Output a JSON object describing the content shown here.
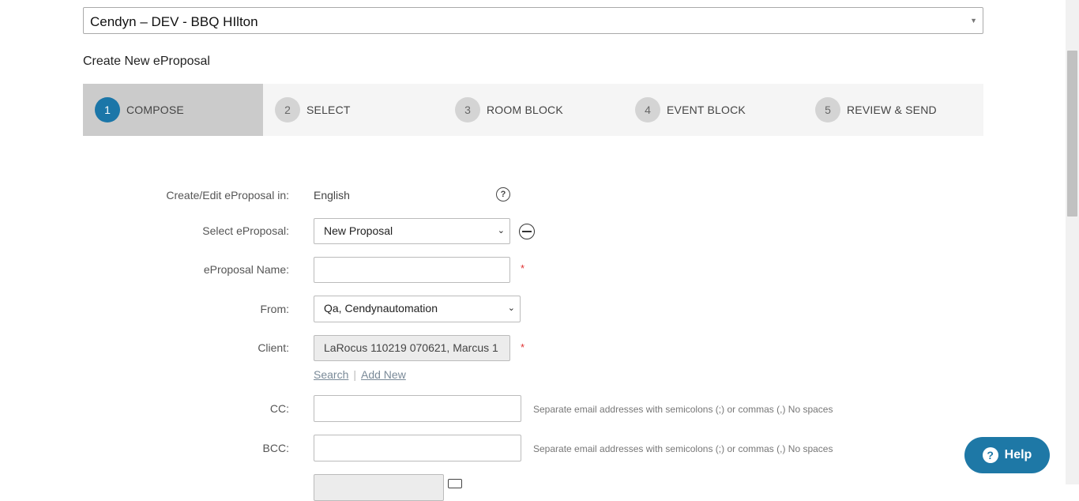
{
  "property": {
    "selected": "Cendyn – DEV - BBQ HIlton"
  },
  "page": {
    "title": "Create New eProposal"
  },
  "steps": [
    {
      "num": "1",
      "label": "COMPOSE"
    },
    {
      "num": "2",
      "label": "SELECT"
    },
    {
      "num": "3",
      "label": "ROOM BLOCK"
    },
    {
      "num": "4",
      "label": "EVENT BLOCK"
    },
    {
      "num": "5",
      "label": "REVIEW & SEND"
    }
  ],
  "form": {
    "language_label": "Create/Edit eProposal in:",
    "language_value": "English",
    "select_label": "Select eProposal:",
    "select_value": "New Proposal",
    "name_label": "eProposal Name:",
    "name_value": "",
    "from_label": "From:",
    "from_value": "Qa, Cendynautomation",
    "client_label": "Client:",
    "client_value": "LaRocus 110219 070621, Marcus 1",
    "search_link": "Search",
    "add_new_link": "Add New",
    "separator": "|",
    "cc_label": "CC:",
    "cc_value": "",
    "cc_hint": "Separate email addresses with semicolons (;) or commas (,) No spaces",
    "bcc_label": "BCC:",
    "bcc_value": "",
    "bcc_hint": "Separate email addresses with semicolons (;) or commas (,) No spaces",
    "required_mark": "*"
  },
  "help_button": {
    "label": "Help"
  },
  "icons": {
    "help": "question-circle-icon",
    "remove": "minus-circle-icon",
    "calendar": "calendar-icon"
  },
  "colors": {
    "accent": "#1b76a8",
    "active_step_bg": "#cbcbcb",
    "required": "#e03030"
  }
}
